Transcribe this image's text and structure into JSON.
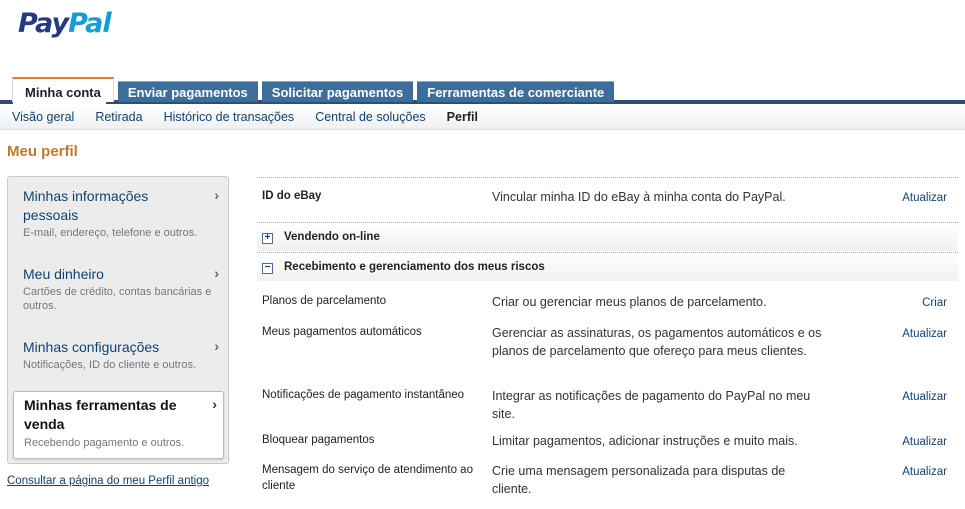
{
  "logo": {
    "part1": "Pay",
    "part2": "Pal"
  },
  "tabs": [
    {
      "label": "Minha conta"
    },
    {
      "label": "Enviar pagamentos"
    },
    {
      "label": "Solicitar pagamentos"
    },
    {
      "label": "Ferramentas de comerciante"
    }
  ],
  "subnav": [
    {
      "label": "Visão geral"
    },
    {
      "label": "Retirada"
    },
    {
      "label": "Histórico de transações"
    },
    {
      "label": "Central de soluções"
    },
    {
      "label": "Perfil"
    }
  ],
  "page_title": "Meu perfil",
  "sidebar": {
    "items": [
      {
        "title": "Minhas informações pessoais",
        "desc": "E-mail, endereço, telefone e outros."
      },
      {
        "title": "Meu dinheiro",
        "desc": "Cartões de crédito, contas bancárias e outros."
      },
      {
        "title": "Minhas configurações",
        "desc": "Notificações, ID do cliente e outros."
      },
      {
        "title": "Minhas ferramentas de venda",
        "desc": "Recebendo pagamento e outros."
      }
    ],
    "chevron": "›",
    "old_profile_link": "Consultar a página do meu Perfil antigo"
  },
  "main": {
    "ebay": {
      "label": "ID do eBay",
      "desc": "Vincular minha ID do eBay à minha conta do PayPal.",
      "action": "Atualizar"
    },
    "sections": [
      {
        "title": "Vendendo on-line",
        "toggle": "+"
      },
      {
        "title": "Recebimento e gerenciamento dos meus riscos",
        "toggle": "−"
      }
    ],
    "rows": [
      {
        "label": "Planos de parcelamento",
        "desc": "Criar ou gerenciar meus planos de parcelamento.",
        "action": "Criar"
      },
      {
        "label": "Meus pagamentos automáticos",
        "desc": "Gerenciar as assinaturas, os pagamentos automáticos e os planos de parcelamento que ofereço para meus clientes.",
        "action": "Atualizar"
      },
      {
        "label": "Notificações de pagamento instantâneo",
        "desc": "Integrar as notificações de pagamento do PayPal no meu site.",
        "action": "Atualizar"
      },
      {
        "label": "Bloquear pagamentos",
        "desc": "Limitar pagamentos, adicionar instruções e muito mais.",
        "action": "Atualizar"
      },
      {
        "label": "Mensagem do serviço de atendimento ao cliente",
        "desc": "Crie uma mensagem personalizada para disputas de cliente.",
        "action": "Atualizar"
      }
    ]
  },
  "colors": {
    "accent": "#e07b33",
    "nav": "#3d6e9b",
    "link": "#11426f",
    "title": "#c0792a"
  }
}
